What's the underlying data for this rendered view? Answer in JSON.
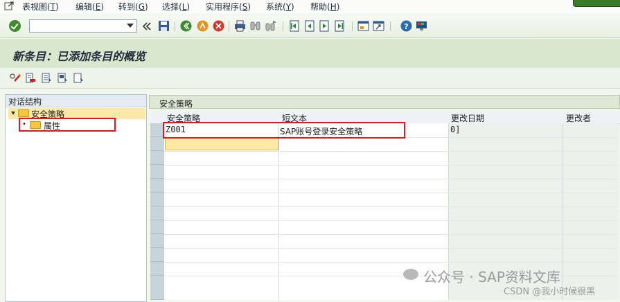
{
  "menubar": {
    "items": [
      {
        "text": "表视图",
        "key": "T"
      },
      {
        "text": "编辑",
        "key": "E"
      },
      {
        "text": "转到",
        "key": "G"
      },
      {
        "text": "选择",
        "key": "L"
      },
      {
        "text": "实用程序",
        "key": "S"
      },
      {
        "text": "系统",
        "key": "Y"
      },
      {
        "text": "帮助",
        "key": "H"
      }
    ]
  },
  "toolbar": {
    "command_field_value": "",
    "icons": [
      "enter-check-icon",
      "save-icon",
      "back-icon",
      "exit-icon",
      "cancel-icon",
      "print-icon",
      "find-icon",
      "find-next-icon",
      "first-page-icon",
      "previous-page-icon",
      "next-page-icon",
      "last-page-icon",
      "create-session-icon",
      "shortcut-icon",
      "help-icon",
      "customize-layout-icon"
    ]
  },
  "title": "新条目：已添加条目的概览",
  "tree": {
    "header": "对话结构",
    "nodes": [
      {
        "label": "安全策略",
        "expanded": true,
        "selected": true
      },
      {
        "label": "属性",
        "expanded": false,
        "selected": false
      }
    ]
  },
  "table": {
    "title": "安全策略",
    "columns": [
      "安全策略",
      "短文本",
      "更改日期",
      "更改者"
    ],
    "rows": [
      {
        "policy": "Z001",
        "short_text": "SAP账号登录安全策略",
        "changed_on": "0]",
        "changed_by": ""
      }
    ]
  },
  "watermark": {
    "line1": "公众号 · SAP资料文库",
    "line2": "CSDN @我小时候很黑"
  },
  "colors": {
    "highlight_red": "#e01818",
    "selected_yellow": "#fbe7a6",
    "title_bg": "#d9e7cf"
  }
}
